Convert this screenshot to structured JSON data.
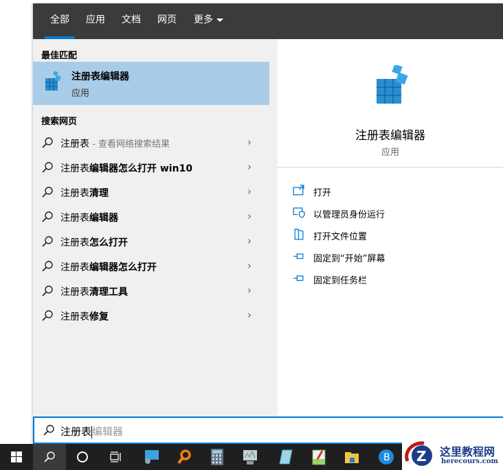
{
  "tabs": [
    {
      "label": "全部"
    },
    {
      "label": "应用"
    },
    {
      "label": "文档"
    },
    {
      "label": "网页"
    },
    {
      "label": "更多"
    }
  ],
  "best_match": {
    "heading": "最佳匹配",
    "title": "注册表编辑器",
    "subtitle": "应用"
  },
  "web": {
    "heading": "搜索网页",
    "items": [
      {
        "query": "注册表",
        "suffix": "",
        "hint": " - 查看网络搜索结果"
      },
      {
        "query": "注册表",
        "suffix": "编辑器怎么打开 win10",
        "hint": ""
      },
      {
        "query": "注册表",
        "suffix": "清理",
        "hint": ""
      },
      {
        "query": "注册表",
        "suffix": "编辑器",
        "hint": ""
      },
      {
        "query": "注册表",
        "suffix": "怎么打开",
        "hint": ""
      },
      {
        "query": "注册表",
        "suffix": "编辑器怎么打开",
        "hint": ""
      },
      {
        "query": "注册表",
        "suffix": "清理工具",
        "hint": ""
      },
      {
        "query": "注册表",
        "suffix": "修复",
        "hint": ""
      }
    ]
  },
  "detail": {
    "title": "注册表编辑器",
    "subtitle": "应用",
    "actions": [
      {
        "label": "打开",
        "icon": "open-icon"
      },
      {
        "label": "以管理员身份运行",
        "icon": "shield-icon"
      },
      {
        "label": "打开文件位置",
        "icon": "folder-icon"
      },
      {
        "label": "固定到“开始”屏幕",
        "icon": "pin-icon"
      },
      {
        "label": "固定到任务栏",
        "icon": "pin-icon"
      }
    ]
  },
  "search": {
    "typed": "注册表",
    "suggestion": "编辑器"
  },
  "watermark": {
    "title": "这里教程网",
    "url": "herecours.com"
  },
  "colors": {
    "accent": "#0078d7",
    "selected": "#a9cce8",
    "header": "#3b3b3b"
  }
}
